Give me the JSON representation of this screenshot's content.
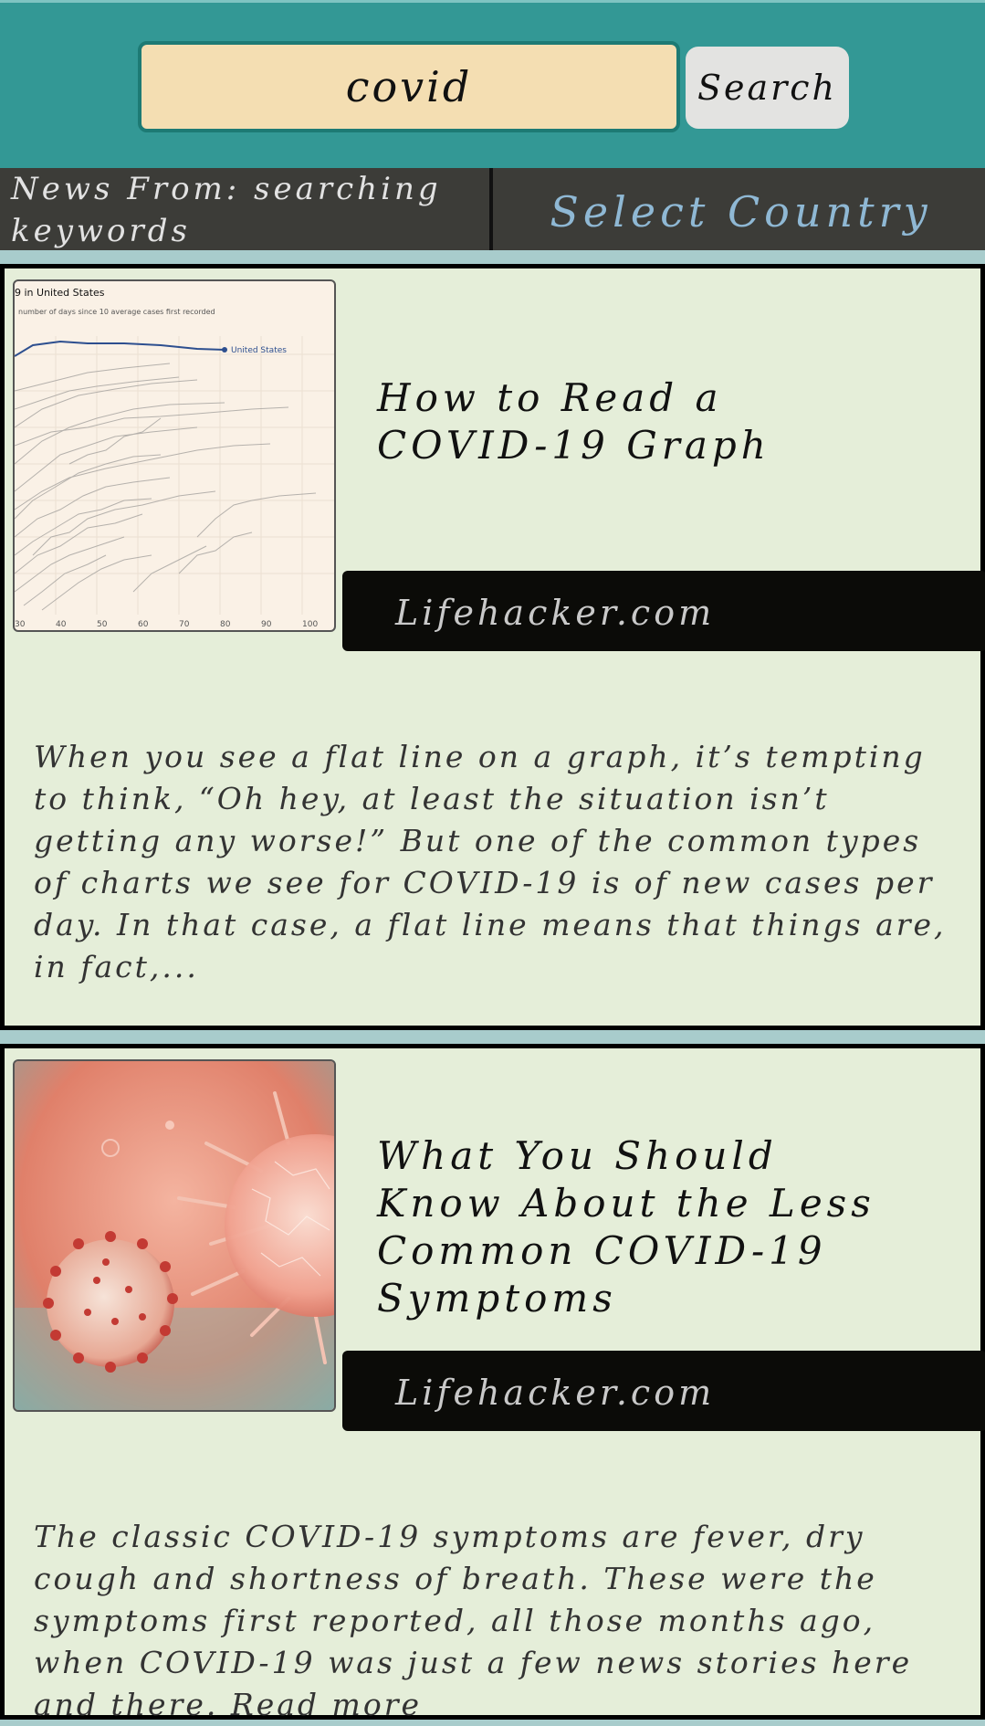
{
  "search": {
    "value": "covid",
    "button_label": "Search"
  },
  "filter": {
    "news_from": "News From: searching keywords",
    "select_country": "Select Country"
  },
  "articles": [
    {
      "title": "How to Read a COVID-19 Graph",
      "source": "Lifehacker.com",
      "description": "When you see a flat line on a graph, it’s tempting to think, “Oh hey, at least the situation isn’t getting any worse!” But one of the common types of charts we see for COVID-19 is of new cases per day. In that case, a flat line means that things are, in fact,...",
      "thumbnail": {
        "title": "9 in United States",
        "subtitle": "number of days since 10 average cases first recorded",
        "series_label": "United States",
        "x_ticks": [
          "30",
          "40",
          "50",
          "60",
          "70",
          "80",
          "90",
          "100"
        ]
      }
    },
    {
      "title": "What You Should Know About the Less Common COVID-19 Symptoms",
      "source": "Lifehacker.com",
      "description": "The classic COVID-19 symptoms are fever, dry cough and shortness of breath. These were the symptoms first reported, all those months ago, when COVID-19 was just a few news stories here and there. Read more"
    }
  ],
  "colors": {
    "header": "#339895",
    "card": "#e5eed9",
    "source_bar": "#0b0b08",
    "search_field": "#f4deb2"
  }
}
